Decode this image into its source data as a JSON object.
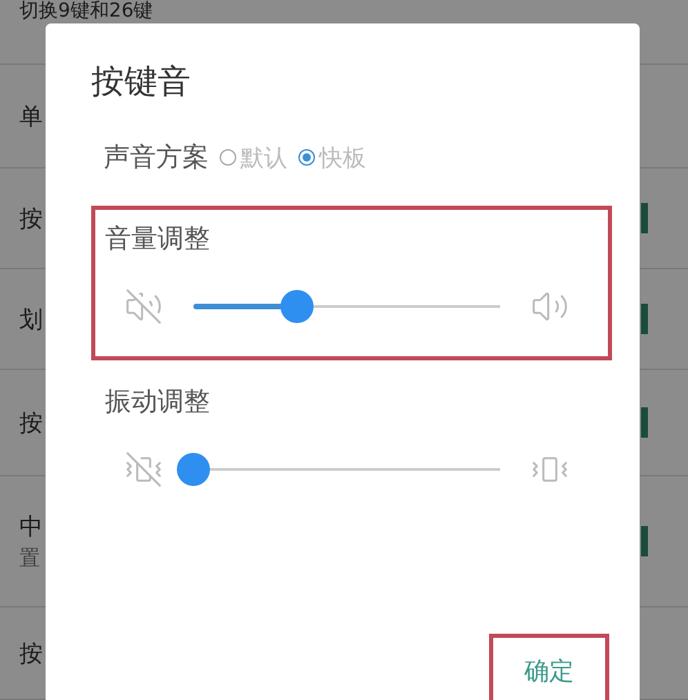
{
  "background_list": {
    "rows": [
      {
        "title": "切换9键和26键"
      },
      {
        "title": "单"
      },
      {
        "title": "按",
        "switch": {
          "on": true
        }
      },
      {
        "title": "划",
        "switch": {
          "on": true
        }
      },
      {
        "title": "按",
        "switch": {
          "on": true
        }
      },
      {
        "title": "中",
        "subtitle": "置",
        "switch": {
          "on": true
        }
      },
      {
        "title": "按"
      }
    ]
  },
  "dialog": {
    "title": "按键音",
    "sound_scheme": {
      "label": "声音方案",
      "options": [
        {
          "label": "默认",
          "selected": false
        },
        {
          "label": "快板",
          "selected": true
        }
      ]
    },
    "sections": [
      {
        "kind": "volume",
        "title": "音量调整",
        "level": 0.34,
        "highlighted": true
      },
      {
        "kind": "vibration",
        "title": "振动调整",
        "level": 0,
        "highlighted": false
      }
    ],
    "button": {
      "label": "确定",
      "highlighted": true
    }
  }
}
